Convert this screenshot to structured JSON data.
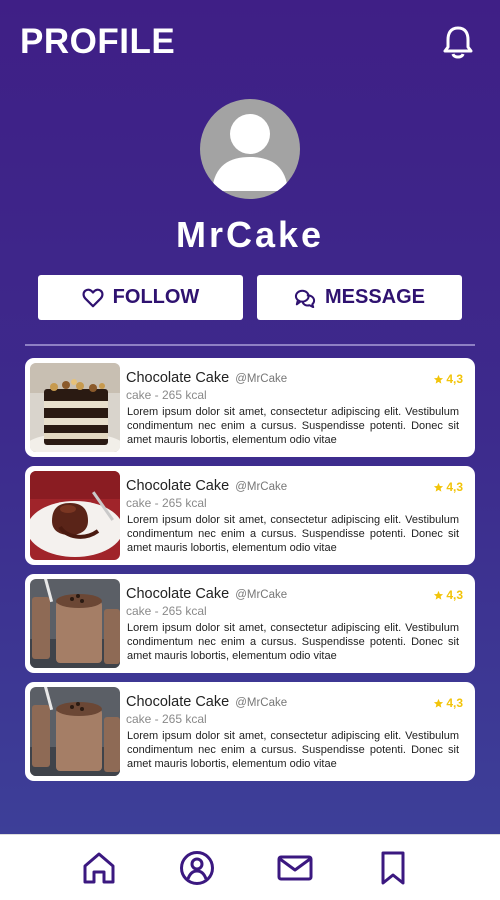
{
  "header": {
    "title": "PROFILE",
    "notification_icon": "bell-icon"
  },
  "profile": {
    "name": "MrCake",
    "avatar_icon": "user-avatar-icon"
  },
  "actions": {
    "follow_label": "FOLLOW",
    "message_label": "MESSAGE"
  },
  "posts": [
    {
      "title": "Chocolate Cake",
      "handle": "@MrCake",
      "subtitle": "cake - 265 kcal",
      "rating": "4,3",
      "description": "Lorem ipsum dolor sit amet, consectetur adipiscing elit. Vestibulum condimentum nec enim a cursus. Suspendisse potenti. Donec sit amet mauris lobortis, elementum odio vitae",
      "image": "layered-chocolate-cake-photo"
    },
    {
      "title": "Chocolate Cake",
      "handle": "@MrCake",
      "subtitle": "cake - 265 kcal",
      "rating": "4,3",
      "description": "Lorem ipsum dolor sit amet, consectetur adipiscing elit. Vestibulum condimentum nec enim a cursus. Suspendisse potenti. Donec sit amet mauris lobortis, elementum odio vitae",
      "image": "lava-cake-photo"
    },
    {
      "title": "Chocolate Cake",
      "handle": "@MrCake",
      "subtitle": "cake - 265 kcal",
      "rating": "4,3",
      "description": "Lorem ipsum dolor sit amet, consectetur adipiscing elit. Vestibulum condimentum nec enim a cursus. Suspendisse potenti. Donec sit amet mauris lobortis, elementum odio vitae",
      "image": "chocolate-milkshake-photo"
    },
    {
      "title": "Chocolate Cake",
      "handle": "@MrCake",
      "subtitle": "cake - 265 kcal",
      "rating": "4,3",
      "description": "Lorem ipsum dolor sit amet, consectetur adipiscing elit. Vestibulum condimentum nec enim a cursus. Suspendisse potenti. Donec sit amet mauris lobortis, elementum odio vitae",
      "image": "chocolate-milkshake-photo"
    }
  ],
  "bottom_nav": [
    "home-icon",
    "profile-icon",
    "mail-icon",
    "bookmark-icon"
  ],
  "colors": {
    "gradient_top": "#3f1f86",
    "gradient_bottom": "#3d3f98",
    "accent": "#2f1270",
    "rating": "#f2c40a"
  }
}
